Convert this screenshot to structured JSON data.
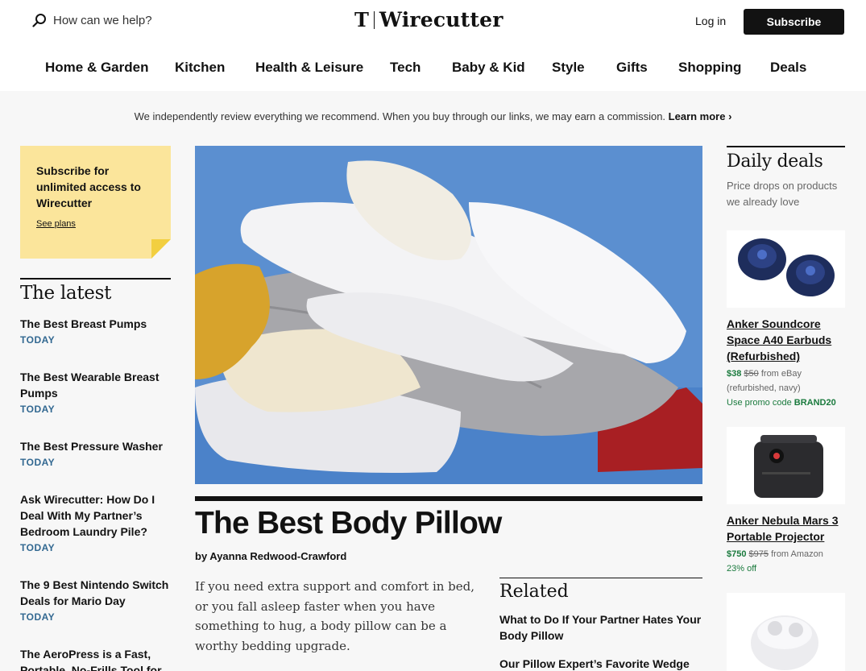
{
  "header": {
    "search_placeholder": "How can we help?",
    "logo_mark": "T",
    "logo_word": "Wirecutter",
    "login_label": "Log in",
    "subscribe_label": "Subscribe"
  },
  "nav": {
    "items": [
      "Home & Garden",
      "Kitchen",
      "Health & Leisure",
      "Tech",
      "Baby & Kid",
      "Style",
      "Gifts",
      "Shopping",
      "Deals"
    ]
  },
  "disclosure": {
    "text": "We independently review everything we recommend. When you buy through our links, we may earn a commission.",
    "link": "Learn more ›"
  },
  "sticky": {
    "title": "Subscribe for unlimited access to Wirecutter",
    "link": "See plans"
  },
  "latest": {
    "heading": "The latest",
    "items": [
      {
        "title": "The Best Breast Pumps",
        "date": "TODAY"
      },
      {
        "title": "The Best Wearable Breast Pumps",
        "date": "TODAY"
      },
      {
        "title": "The Best Pressure Washer",
        "date": "TODAY"
      },
      {
        "title": "Ask Wirecutter: How Do I Deal With My Partner’s Bedroom Laundry Pile?",
        "date": "TODAY"
      },
      {
        "title": "The 9 Best Nintendo Switch Deals for Mario Day",
        "date": "TODAY"
      },
      {
        "title": "The AeroPress is a Fast, Portable, No-Frills Tool for",
        "date": ""
      }
    ]
  },
  "article": {
    "headline": "The Best Body Pillow",
    "byline": "by Ayanna Redwood-Crawford",
    "summary": "If you need extra support and comfort in bed, or you fall asleep faster when you have something to hug, a body pillow can be a worthy bedding upgrade.",
    "image_alt": "pillows-stack-image"
  },
  "related": {
    "heading": "Related",
    "items": [
      "What to Do If Your Partner Hates Your Body Pillow",
      "Our Pillow Expert’s Favorite Wedge"
    ]
  },
  "deals": {
    "heading": "Daily deals",
    "subheading": "Price drops on products we already love",
    "items": [
      {
        "title": "Anker Soundcore Space A40 Earbuds (Refurbished)",
        "price": "$38",
        "was": "$50",
        "source": "from eBay",
        "note": "(refurbished, navy)",
        "promo_prefix": "Use promo code",
        "promo_code": "BRAND20"
      },
      {
        "title": "Anker Nebula Mars 3 Portable Projector",
        "price": "$750",
        "was": "$975",
        "source": "from Amazon",
        "note": "",
        "promo_prefix": "23% off",
        "promo_code": ""
      }
    ]
  },
  "colors": {
    "accent_blue": "#326891",
    "deal_green": "#1a7a3d",
    "sticky_yellow": "#fbe59b",
    "hero_bg": "#5b8fd0"
  }
}
